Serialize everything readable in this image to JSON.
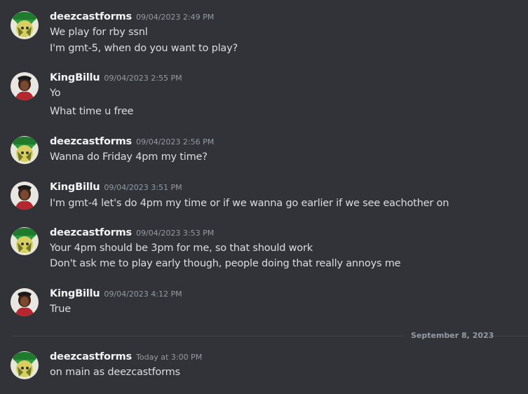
{
  "messages": [
    {
      "author": "deezcastforms",
      "timestamp": "09/04/2023 2:49 PM",
      "lines": [
        "We play for rby ssnl",
        "I'm gmt-5, when do you want to play?"
      ]
    },
    {
      "author": "KingBillu",
      "timestamp": "09/04/2023 2:55 PM",
      "lines": [
        "Yo",
        "What time u free"
      ]
    },
    {
      "author": "deezcastforms",
      "timestamp": "09/04/2023 2:56 PM",
      "lines": [
        "Wanna do Friday 4pm my time?"
      ]
    },
    {
      "author": "KingBillu",
      "timestamp": "09/04/2023 3:51 PM",
      "lines": [
        "I'm gmt-4 let's do 4pm my time or if we wanna go earlier if we see eachother on"
      ]
    },
    {
      "author": "deezcastforms",
      "timestamp": "09/04/2023 3:53 PM",
      "lines": [
        "Your 4pm should be 3pm for me, so that should work",
        "Don't ask me to play early though, people doing that really annoys me"
      ]
    },
    {
      "author": "KingBillu",
      "timestamp": "09/04/2023 4:12 PM",
      "lines": [
        "True"
      ]
    },
    {
      "author": "deezcastforms",
      "timestamp": "Today at 3:00 PM",
      "lines": [
        "on main as deezcastforms"
      ]
    }
  ],
  "date_divider": {
    "label": "September 8, 2023"
  },
  "colors": {
    "background": "#313338",
    "username": "#f2f3f5",
    "message_text": "#dbdee1",
    "timestamp": "#949ba4",
    "divider": "#3f4147"
  }
}
